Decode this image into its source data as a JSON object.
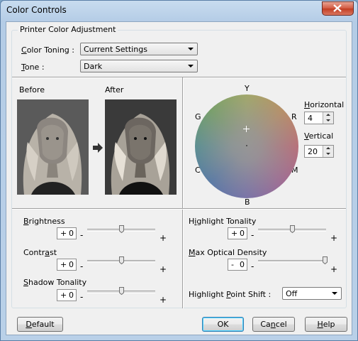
{
  "window": {
    "title": "Color Controls"
  },
  "group": {
    "title": "Printer Color Adjustment"
  },
  "color_toning": {
    "label_pre": "",
    "label_u": "C",
    "label_post": "olor Toning :",
    "value": "Current Settings"
  },
  "tone": {
    "label_pre": "",
    "label_u": "T",
    "label_post": "one :",
    "value": "Dark"
  },
  "preview": {
    "before_label": "Before",
    "after_label": "After"
  },
  "wheel": {
    "Y": "Y",
    "R": "R",
    "M": "M",
    "B": "B",
    "C": "C",
    "G": "G"
  },
  "horizontal": {
    "label_pre": "",
    "label_u": "H",
    "label_post": "orizontal",
    "value": "4"
  },
  "vertical": {
    "label_pre": "",
    "label_u": "V",
    "label_post": "ertical",
    "value": "20"
  },
  "sliders_left": [
    {
      "pre": "",
      "u": "B",
      "post": "rightness",
      "sign": "+",
      "value": "0",
      "minus": "-",
      "plus": "+",
      "level": 0.5
    },
    {
      "pre": "Contr",
      "u": "a",
      "post": "st",
      "sign": "+",
      "value": "0",
      "minus": "-",
      "plus": "+",
      "level": 0.5
    },
    {
      "pre": "",
      "u": "S",
      "post": "hadow Tonality",
      "sign": "+",
      "value": "0",
      "minus": "-",
      "plus": "+",
      "level": 0.5
    }
  ],
  "sliders_right": [
    {
      "pre": "H",
      "u": "i",
      "post": "ghlight Tonality",
      "sign": "+",
      "value": "0",
      "minus": "-",
      "plus": "+",
      "level": 0.5
    },
    {
      "pre": "",
      "u": "M",
      "post": "ax Optical Density",
      "sign": "-",
      "value": "0",
      "minus": "-",
      "plus": "+",
      "level": 1.0
    }
  ],
  "highlight_point_shift": {
    "pre": "Highlight ",
    "u": "P",
    "post": "oint Shift :",
    "value": "Off"
  },
  "buttons": {
    "default": {
      "u": "D",
      "post": "efault"
    },
    "ok": "OK",
    "cancel": {
      "pre": "Ca",
      "u": "n",
      "post": "cel"
    },
    "help": {
      "u": "H",
      "post": "elp"
    }
  }
}
